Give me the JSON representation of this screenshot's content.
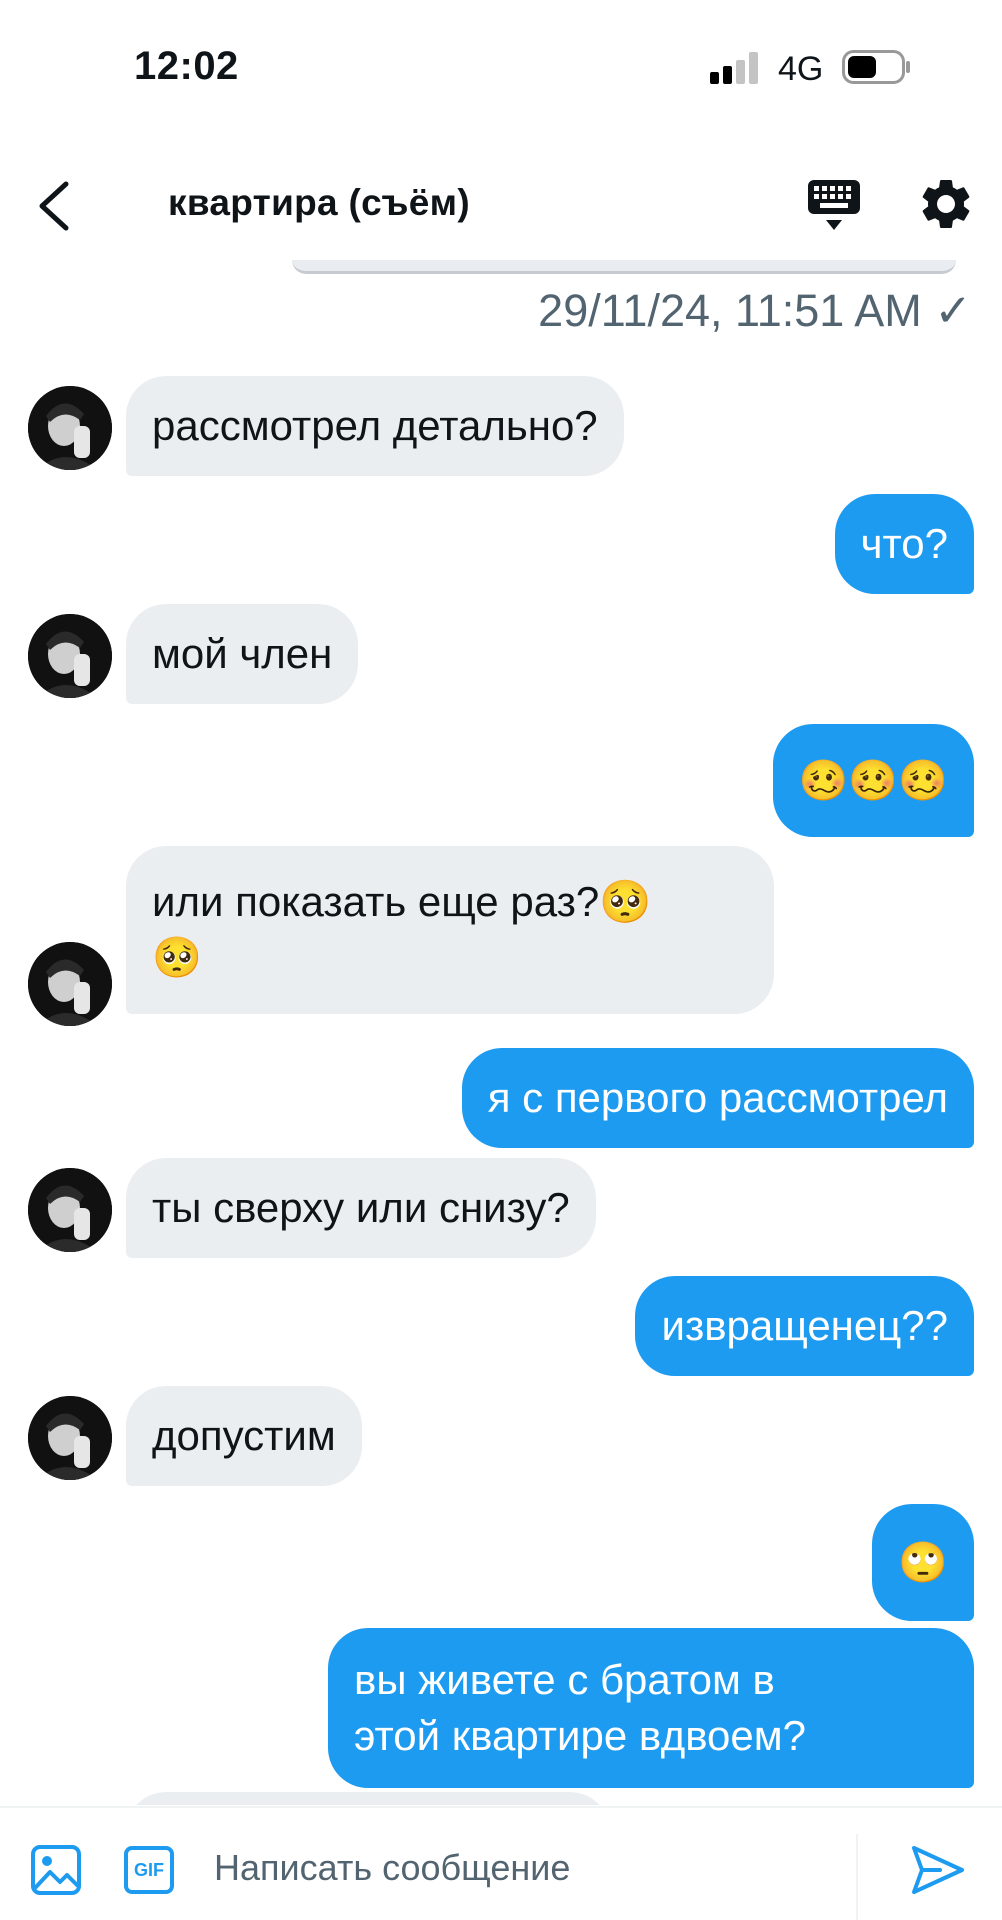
{
  "status_bar": {
    "time": "12:02",
    "network": "4G",
    "icons": [
      "signal-icon",
      "battery-icon"
    ]
  },
  "header": {
    "title": "квартира (съём)",
    "icons": [
      "back-arrow-icon",
      "keyboard-icon",
      "gear-icon"
    ]
  },
  "thread": {
    "timestamp": "29/11/24, 11:51 AM ✓",
    "messages": [
      {
        "side": "in",
        "text": "рассмотрел детально?"
      },
      {
        "side": "out",
        "text": "что?"
      },
      {
        "side": "in",
        "text": "мой член"
      },
      {
        "side": "out",
        "text": "🥴🥴🥴"
      },
      {
        "side": "in",
        "text": "или показать еще раз?🥺",
        "text2": "🥺"
      },
      {
        "side": "out",
        "text": "я с первого рассмотрел"
      },
      {
        "side": "in",
        "text": "ты сверху или снизу?"
      },
      {
        "side": "out",
        "text": "извращенец??"
      },
      {
        "side": "in",
        "text": "допустим"
      },
      {
        "side": "out",
        "text": "🙄"
      },
      {
        "side": "out",
        "text": "вы живете с братом в",
        "text2": "этой квартире вдвоем?"
      }
    ]
  },
  "composer": {
    "gif_label": "GIF",
    "placeholder": "Написать сообщение",
    "value": "",
    "icons": [
      "image-icon",
      "send-icon"
    ]
  },
  "colors": {
    "accent": "#1d9bf0",
    "incoming_bubble": "#ebeef1",
    "text": "#0f1419",
    "muted": "#536471"
  }
}
